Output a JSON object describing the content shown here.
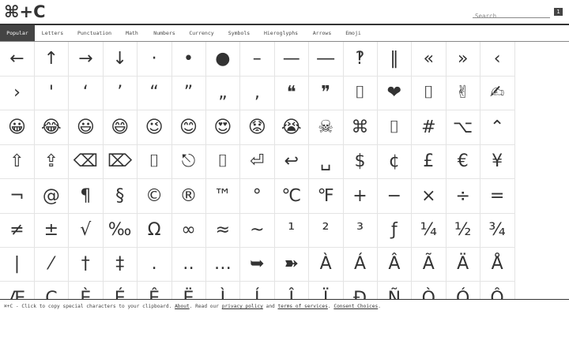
{
  "header": {
    "logo": "⌘+C",
    "search_placeholder": "Search",
    "count": "1"
  },
  "nav": {
    "tabs": [
      "Popular",
      "Letters",
      "Punctuation",
      "Math",
      "Numbers",
      "Currency",
      "Symbols",
      "Hieroglyphs",
      "Arrows",
      "Emoji"
    ],
    "active": "Popular"
  },
  "grid": {
    "rows": [
      [
        "←",
        "↑",
        "→",
        "↓",
        "·",
        "•",
        "●",
        "–",
        "—",
        "―",
        "‽",
        "‖",
        "«",
        "»",
        "‹"
      ],
      [
        "›",
        "'",
        "‘",
        "’",
        "“",
        "”",
        "„",
        "‚",
        "❝",
        "❞",
        "⌷",
        "❤",
        "⌷",
        "✌",
        "✍"
      ],
      [
        "😀",
        "😂",
        "😃",
        "😄",
        "😉",
        "😊",
        "😍",
        "😟",
        "😭",
        "☠",
        "⌘",
        "⌷",
        "#",
        "⌥",
        "⌃"
      ],
      [
        "⇧",
        "⇪",
        "⌫",
        "⌦",
        "⌷",
        "⎋",
        "⌷",
        "⏎",
        "↩",
        "␣",
        "$",
        "¢",
        "£",
        "€",
        "¥"
      ],
      [
        "¬",
        "@",
        "¶",
        "§",
        "©",
        "®",
        "™",
        "°",
        "℃",
        "℉",
        "+",
        "−",
        "×",
        "÷",
        "="
      ],
      [
        "≠",
        "±",
        "√",
        "‰",
        "Ω",
        "∞",
        "≈",
        "~",
        "¹",
        "²",
        "³",
        "ƒ",
        "¼",
        "½",
        "¾"
      ],
      [
        "|",
        "⁄",
        "†",
        "‡",
        ".",
        "‥",
        "…",
        "➥",
        "➽",
        "À",
        "Á",
        "Â",
        "Ã",
        "Ä",
        "Å"
      ],
      [
        "Æ",
        "Ç",
        "È",
        "É",
        "Ê",
        "Ë",
        "Ì",
        "Í",
        "Î",
        "Ï",
        "Ð",
        "Ñ",
        "Ò",
        "Ó",
        "Ô"
      ]
    ]
  },
  "footer": {
    "prefix": "⌘+C - Click to copy special characters to your clipboard.",
    "about": "About",
    "read_our": ". Read our",
    "privacy": "privacy policy",
    "and": "and",
    "terms": "terms of services",
    "sep": ".",
    "consent": "Consent Choices",
    "end": "."
  }
}
